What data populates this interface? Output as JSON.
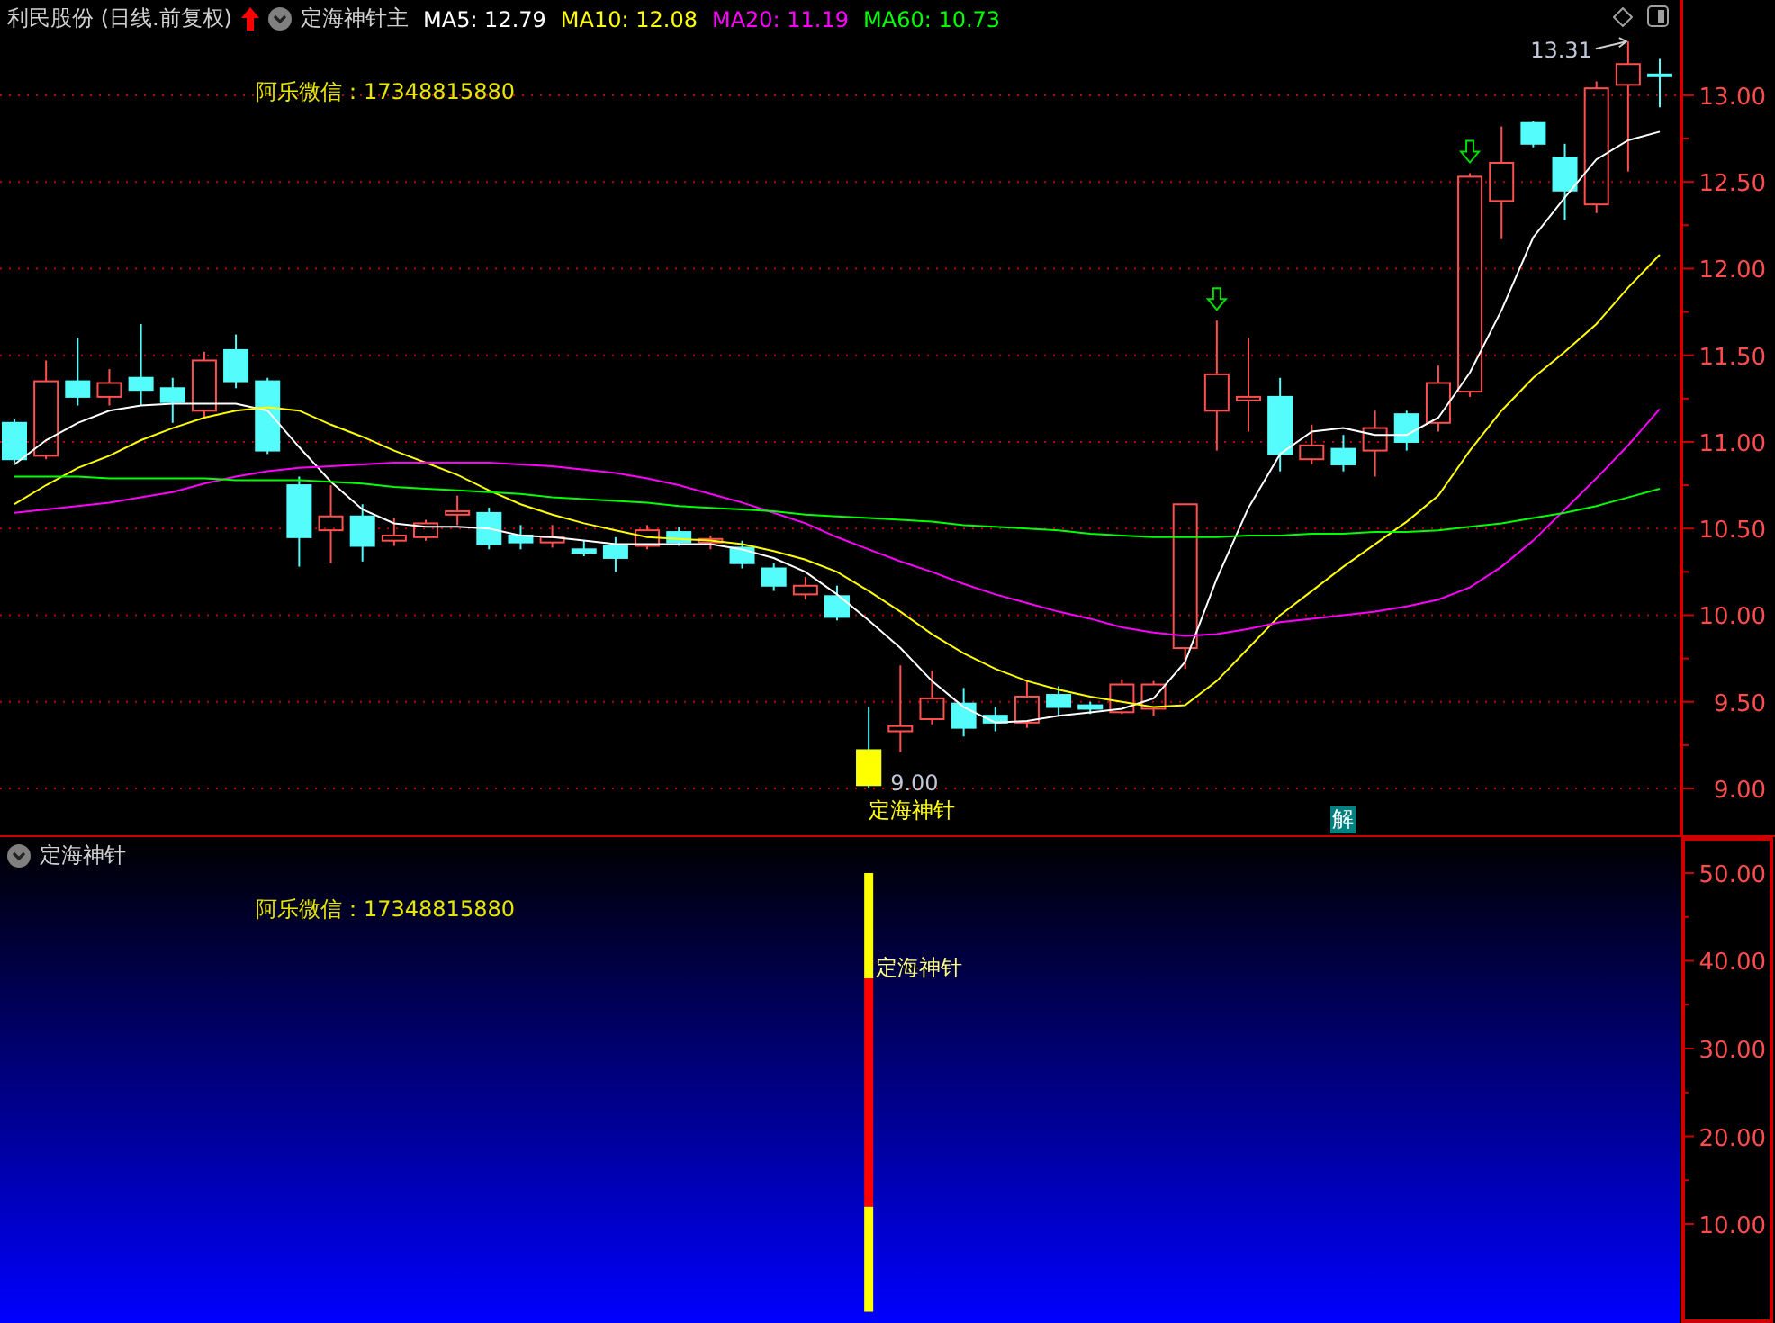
{
  "main_panel": {
    "title": "利民股份 (日线.前复权)",
    "formula": "定海神针主",
    "ma_legend": [
      {
        "text": "MA5: 12.79",
        "color": "#ffffff"
      },
      {
        "text": "MA10: 12.08",
        "color": "#ffff00"
      },
      {
        "text": "MA20: 11.19",
        "color": "#ff00ff"
      },
      {
        "text": "MA60: 10.73",
        "color": "#00ff00"
      }
    ],
    "note": "阿乐微信：17348815880",
    "badge": "解",
    "arrow_marks": [
      false,
      false,
      false,
      false,
      false,
      false,
      false,
      false,
      false,
      false,
      false,
      false,
      false,
      false,
      false,
      false,
      false,
      false,
      false,
      false,
      false,
      false,
      false,
      false,
      false,
      false,
      false,
      false,
      false,
      false,
      false,
      false,
      false,
      false,
      false,
      false,
      false,
      false,
      true,
      false,
      false,
      false,
      false,
      false,
      false,
      false,
      true,
      false,
      false,
      false,
      false,
      false,
      false
    ],
    "chart_data": {
      "type": "candlestick",
      "grid": true,
      "ylim": [
        8.73,
        13.55
      ],
      "categories": [
        null,
        null,
        null,
        null,
        null,
        null,
        null,
        null,
        null,
        null,
        null,
        null,
        null,
        null,
        null,
        null,
        null,
        null,
        null,
        null,
        null,
        null,
        null,
        null,
        null,
        null,
        null,
        null,
        null,
        null,
        null,
        null,
        null,
        null,
        null,
        null,
        null,
        null,
        null,
        null,
        null,
        null,
        null,
        null,
        null,
        null,
        null,
        null,
        null,
        null,
        null,
        null,
        null
      ],
      "yticks": [
        {
          "value": 9,
          "label": "9.00"
        },
        {
          "value": 9.5,
          "label": "9.50"
        },
        {
          "value": 10,
          "label": "10.00"
        },
        {
          "value": 10.5,
          "label": "10.50"
        },
        {
          "value": 11,
          "label": "11.00"
        },
        {
          "value": 11.5,
          "label": "11.50"
        },
        {
          "value": 12,
          "label": "12.00"
        },
        {
          "value": 12.5,
          "label": "12.50"
        },
        {
          "value": 13,
          "label": "13.00"
        }
      ],
      "ohlc": [
        [
          11.11,
          11.13,
          10.88,
          10.9
        ],
        [
          10.92,
          11.47,
          10.9,
          11.35
        ],
        [
          11.35,
          11.6,
          11.21,
          11.26
        ],
        [
          11.26,
          11.42,
          11.21,
          11.34
        ],
        [
          11.37,
          11.68,
          11.21,
          11.3
        ],
        [
          11.31,
          11.37,
          11.11,
          11.23
        ],
        [
          11.18,
          11.52,
          11.14,
          11.47
        ],
        [
          11.53,
          11.62,
          11.31,
          11.35
        ],
        [
          11.35,
          11.37,
          10.93,
          10.95
        ],
        [
          10.75,
          10.8,
          10.28,
          10.45
        ],
        [
          10.49,
          10.75,
          10.3,
          10.57
        ],
        [
          10.57,
          10.64,
          10.31,
          10.4
        ],
        [
          10.43,
          10.56,
          10.4,
          10.46
        ],
        [
          10.45,
          10.55,
          10.43,
          10.53
        ],
        [
          10.58,
          10.69,
          10.52,
          10.6
        ],
        [
          10.59,
          10.62,
          10.38,
          10.41
        ],
        [
          10.46,
          10.52,
          10.38,
          10.42
        ],
        [
          10.42,
          10.52,
          10.39,
          10.45
        ],
        [
          10.38,
          10.43,
          10.34,
          10.36
        ],
        [
          10.4,
          10.45,
          10.25,
          10.33
        ],
        [
          10.4,
          10.52,
          10.38,
          10.49
        ],
        [
          10.48,
          10.51,
          10.4,
          10.42
        ],
        [
          10.42,
          10.46,
          10.38,
          10.44
        ],
        [
          10.39,
          10.43,
          10.27,
          10.3
        ],
        [
          10.27,
          10.3,
          10.14,
          10.17
        ],
        [
          10.12,
          10.22,
          10.09,
          10.17
        ],
        [
          10.11,
          10.17,
          9.97,
          9.99
        ],
        [
          9.22,
          9.47,
          9.0,
          9.02
        ],
        [
          9.33,
          9.71,
          9.21,
          9.36
        ],
        [
          9.4,
          9.68,
          9.37,
          9.52
        ],
        [
          9.49,
          9.58,
          9.3,
          9.35
        ],
        [
          9.42,
          9.47,
          9.33,
          9.38
        ],
        [
          9.38,
          9.62,
          9.35,
          9.53
        ],
        [
          9.54,
          9.59,
          9.42,
          9.47
        ],
        [
          9.48,
          9.5,
          9.43,
          9.46
        ],
        [
          9.44,
          9.63,
          9.43,
          9.6
        ],
        [
          9.46,
          9.62,
          9.42,
          9.6
        ],
        [
          9.81,
          10.64,
          9.69,
          10.64
        ],
        [
          11.18,
          11.7,
          10.95,
          11.39
        ],
        [
          11.24,
          11.6,
          11.06,
          11.26
        ],
        [
          11.26,
          11.37,
          10.83,
          10.93
        ],
        [
          10.9,
          11.1,
          10.87,
          10.98
        ],
        [
          10.96,
          11.04,
          10.83,
          10.87
        ],
        [
          10.95,
          11.18,
          10.8,
          11.08
        ],
        [
          11.16,
          11.18,
          10.95,
          11.0
        ],
        [
          11.11,
          11.44,
          11.06,
          11.34
        ],
        [
          11.29,
          12.55,
          11.26,
          12.53
        ],
        [
          12.39,
          12.82,
          12.17,
          12.61
        ],
        [
          12.84,
          12.85,
          12.7,
          12.72
        ],
        [
          12.64,
          12.72,
          12.28,
          12.45
        ],
        [
          12.37,
          13.08,
          12.32,
          13.04
        ],
        [
          13.06,
          13.31,
          12.56,
          13.18
        ],
        [
          13.12,
          13.21,
          12.93,
          13.11
        ]
      ],
      "series": [
        {
          "type": "line",
          "color": "#ffffff",
          "values": [
            10.87,
            11.01,
            11.11,
            11.18,
            11.21,
            11.22,
            11.22,
            11.22,
            11.18,
            10.97,
            10.77,
            10.61,
            10.53,
            10.51,
            10.51,
            10.5,
            10.46,
            10.45,
            10.43,
            10.41,
            10.41,
            10.41,
            10.41,
            10.38,
            10.33,
            10.25,
            10.12,
            9.97,
            9.81,
            9.62,
            9.47,
            9.38,
            9.39,
            9.42,
            9.44,
            9.46,
            9.52,
            9.73,
            10.21,
            10.62,
            10.93,
            11.06,
            11.08,
            11.04,
            11.04,
            11.14,
            11.4,
            11.76,
            12.18,
            12.41,
            12.63,
            12.74,
            12.79
          ]
        },
        {
          "type": "line",
          "color": "#ffff00",
          "values": [
            10.64,
            10.75,
            10.85,
            10.92,
            11.01,
            11.08,
            11.14,
            11.18,
            11.2,
            11.18,
            11.1,
            11.03,
            10.95,
            10.88,
            10.81,
            10.72,
            10.64,
            10.58,
            10.53,
            10.49,
            10.45,
            10.44,
            10.43,
            10.41,
            10.37,
            10.32,
            10.25,
            10.14,
            10.02,
            9.89,
            9.78,
            9.69,
            9.62,
            9.57,
            9.53,
            9.5,
            9.47,
            9.48,
            9.62,
            9.81,
            10.0,
            10.14,
            10.28,
            10.41,
            10.54,
            10.69,
            10.95,
            11.18,
            11.37,
            11.52,
            11.68,
            11.89,
            12.08
          ]
        },
        {
          "type": "line",
          "color": "#ff00ff",
          "values": [
            10.59,
            10.61,
            10.63,
            10.65,
            10.68,
            10.71,
            10.76,
            10.8,
            10.83,
            10.85,
            10.86,
            10.87,
            10.88,
            10.88,
            10.88,
            10.88,
            10.87,
            10.86,
            10.84,
            10.82,
            10.79,
            10.75,
            10.7,
            10.65,
            10.59,
            10.53,
            10.45,
            10.38,
            10.31,
            10.25,
            10.18,
            10.12,
            10.07,
            10.02,
            9.98,
            9.93,
            9.9,
            9.88,
            9.89,
            9.92,
            9.96,
            9.98,
            10.0,
            10.02,
            10.05,
            10.09,
            10.16,
            10.28,
            10.43,
            10.61,
            10.79,
            10.98,
            11.19
          ]
        },
        {
          "type": "line",
          "color": "#00ff00",
          "values": [
            10.8,
            10.8,
            10.8,
            10.79,
            10.79,
            10.79,
            10.79,
            10.78,
            10.78,
            10.78,
            10.77,
            10.76,
            10.74,
            10.73,
            10.72,
            10.71,
            10.7,
            10.68,
            10.67,
            10.66,
            10.65,
            10.63,
            10.62,
            10.61,
            10.6,
            10.58,
            10.57,
            10.56,
            10.55,
            10.54,
            10.52,
            10.51,
            10.5,
            10.49,
            10.47,
            10.46,
            10.45,
            10.45,
            10.45,
            10.46,
            10.46,
            10.47,
            10.47,
            10.48,
            10.48,
            10.49,
            10.51,
            10.53,
            10.56,
            10.59,
            10.63,
            10.68,
            10.73
          ]
        }
      ],
      "annotations": [
        "9.00",
        "定海神针",
        "13.31"
      ]
    }
  },
  "indicator_panel": {
    "title": "定海神针",
    "note": "阿乐微信：17348815880",
    "chart_data": {
      "type": "bar",
      "stacked": true,
      "ylim": [
        -1.28,
        54.1
      ],
      "categories": [
        null,
        null,
        null,
        null,
        null,
        null,
        null,
        null,
        null,
        null,
        null,
        null,
        null,
        null,
        null,
        null,
        null,
        null,
        null,
        null,
        null,
        null,
        null,
        null,
        null,
        null,
        null,
        null,
        null,
        null,
        null,
        null,
        null,
        null,
        null,
        null,
        null,
        null,
        null,
        null,
        null,
        null,
        null,
        null,
        null,
        null,
        null,
        null,
        null,
        null,
        null,
        null,
        null
      ],
      "yticks": [
        {
          "value": 10,
          "label": "10.00"
        },
        {
          "value": 20,
          "label": "20.00"
        },
        {
          "value": 30,
          "label": "30.00"
        },
        {
          "value": 40,
          "label": "40.00"
        },
        {
          "value": 50,
          "label": "50.00"
        }
      ],
      "series": [
        {
          "color": "#ffff00",
          "values": [
            null,
            null,
            null,
            null,
            null,
            null,
            null,
            null,
            null,
            null,
            null,
            null,
            null,
            null,
            null,
            null,
            null,
            null,
            null,
            null,
            null,
            null,
            null,
            null,
            null,
            null,
            null,
            12,
            null,
            null,
            null,
            null,
            null,
            null,
            null,
            null,
            null,
            null,
            null,
            null,
            null,
            null,
            null,
            null,
            null,
            null,
            null,
            null,
            null,
            null,
            null,
            null,
            null
          ]
        },
        {
          "color": "#ff0000",
          "values": [
            null,
            null,
            null,
            null,
            null,
            null,
            null,
            null,
            null,
            null,
            null,
            null,
            null,
            null,
            null,
            null,
            null,
            null,
            null,
            null,
            null,
            null,
            null,
            null,
            null,
            null,
            null,
            26,
            null,
            null,
            null,
            null,
            null,
            null,
            null,
            null,
            null,
            null,
            null,
            null,
            null,
            null,
            null,
            null,
            null,
            null,
            null,
            null,
            null,
            null,
            null,
            null,
            null
          ]
        },
        {
          "color": "#ffff00",
          "values": [
            null,
            null,
            null,
            null,
            null,
            null,
            null,
            null,
            null,
            null,
            null,
            null,
            null,
            null,
            null,
            null,
            null,
            null,
            null,
            null,
            null,
            null,
            null,
            null,
            null,
            null,
            null,
            12,
            null,
            null,
            null,
            null,
            null,
            null,
            null,
            null,
            null,
            null,
            null,
            null,
            null,
            null,
            null,
            null,
            null,
            null,
            null,
            null,
            null,
            null,
            null,
            null,
            null
          ]
        }
      ],
      "annotations": [
        "定海神针"
      ]
    }
  }
}
